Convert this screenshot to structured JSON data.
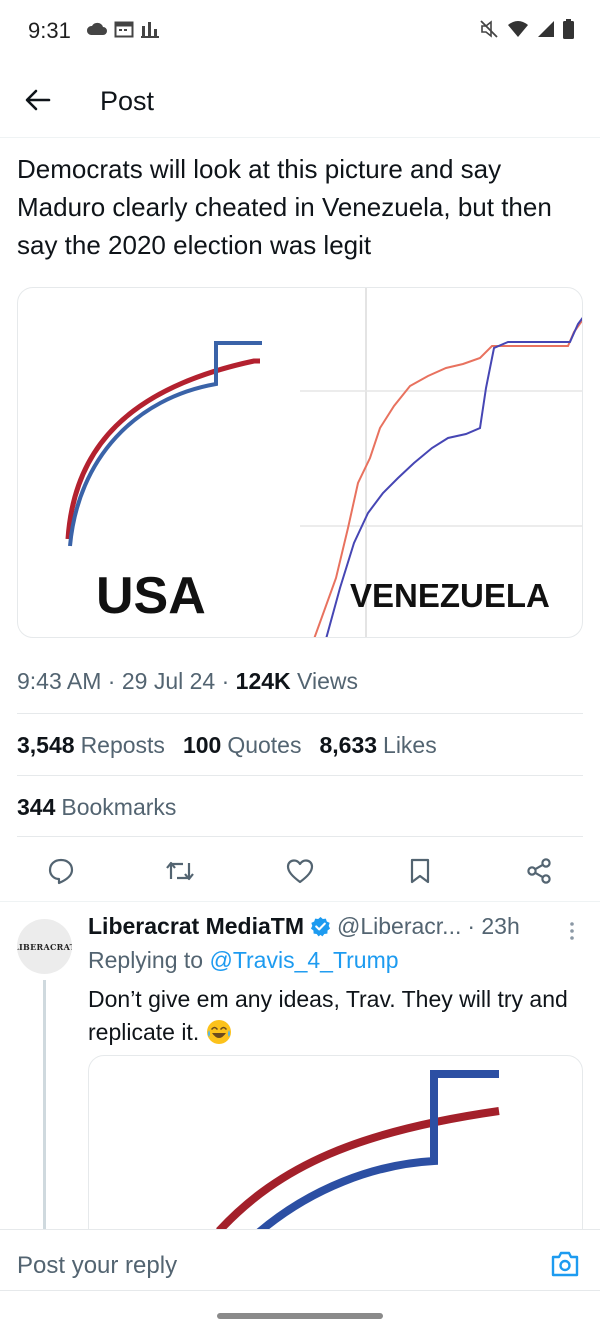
{
  "status_bar": {
    "time": "9:31",
    "left_icons": [
      "cloud-icon",
      "calendar-icon",
      "chart-icon"
    ],
    "right_icons": [
      "mute-icon",
      "wifi-icon",
      "signal-icon",
      "battery-icon"
    ]
  },
  "header": {
    "back_icon": "arrow-left-icon",
    "title": "Post"
  },
  "post": {
    "text": "Democrats will look at this picture and say Maduro clearly cheated in Venezuela, but then say the 2020 election was legit",
    "image": {
      "left_label": "USA",
      "right_label": "VENEZUELA",
      "colors": {
        "red": "#b3212f",
        "blue": "#3a63a8",
        "venezuela_red": "#e8725f",
        "venezuela_blue": "#4646b4"
      }
    },
    "time": "9:43 AM",
    "date": "29 Jul 24",
    "views_count": "124K",
    "views_label": "Views",
    "separator": "·",
    "stats": {
      "reposts_count": "3,548",
      "reposts_label": "Reposts",
      "quotes_count": "100",
      "quotes_label": "Quotes",
      "likes_count": "8,633",
      "likes_label": "Likes",
      "bookmarks_count": "344",
      "bookmarks_label": "Bookmarks"
    },
    "actions": [
      "reply-icon",
      "repost-icon",
      "like-icon",
      "bookmark-icon",
      "share-icon"
    ]
  },
  "reply": {
    "avatar_text": "LIBERACRAT",
    "name": "Liberacrat MediaTM",
    "handle": "@Liberacr...",
    "age": "· 23h",
    "replying_prefix": "Replying to",
    "replying_to": "@Travis_4_Trump",
    "text": "Don’t give em any ideas, Trav. They will try and replicate it.",
    "emoji": "laughing-tears-emoji"
  },
  "composer": {
    "placeholder": "Post your reply",
    "camera_icon": "camera-icon"
  }
}
